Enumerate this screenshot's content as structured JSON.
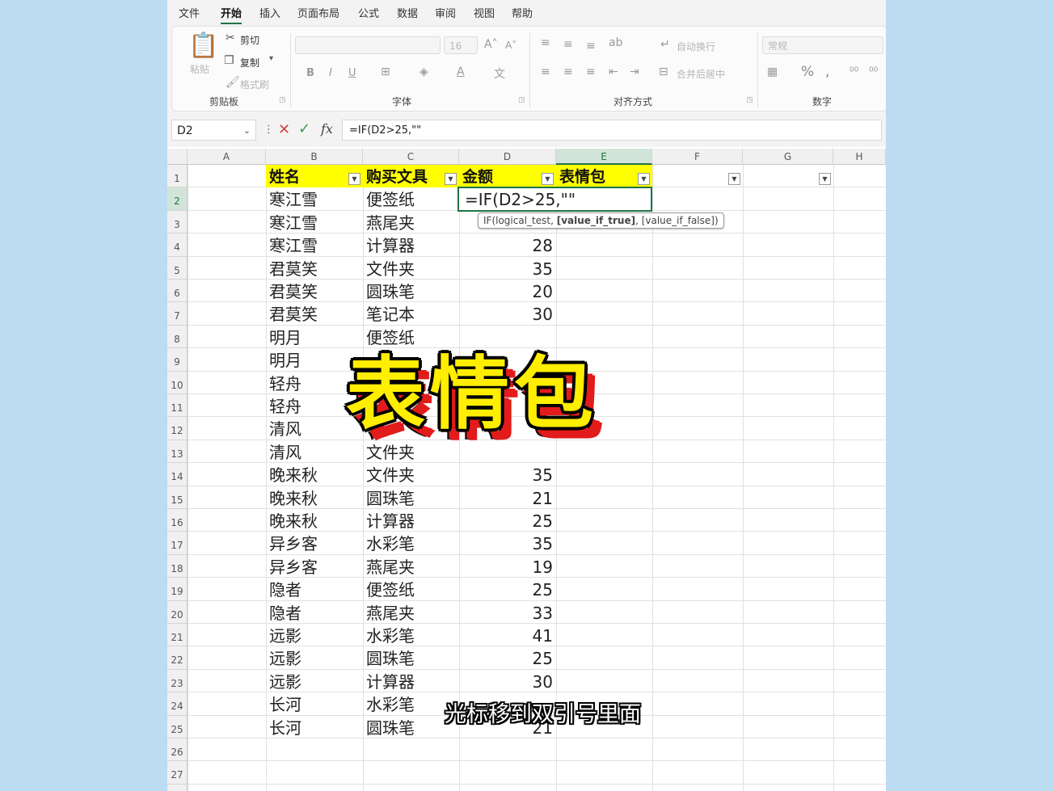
{
  "menu": [
    "文件",
    "开始",
    "插入",
    "页面布局",
    "公式",
    "数据",
    "审阅",
    "视图",
    "帮助"
  ],
  "ribbon": {
    "paste": "粘贴",
    "cut": "剪切",
    "copy": "复制",
    "format_painter": "格式刷",
    "clipboard_group": "剪贴板",
    "font_size": "16",
    "font_group": "字体",
    "wrap_text": "自动换行",
    "merge_center": "合并后居中",
    "align_group": "对齐方式",
    "number_format": "常规",
    "number_group": "数字"
  },
  "formula_bar": {
    "name_box": "D2",
    "fx": "fx",
    "formula": "=IF(D2>25,\"\""
  },
  "columns": [
    "A",
    "B",
    "C",
    "D",
    "E",
    "F",
    "G",
    "H"
  ],
  "header_row": [
    "姓名",
    "购买文具",
    "金额",
    "表情包"
  ],
  "rows": [
    [
      "寒江雪",
      "便签纸",
      ""
    ],
    [
      "寒江雪",
      "燕尾夹",
      ""
    ],
    [
      "寒江雪",
      "计算器",
      "28"
    ],
    [
      "君莫笑",
      "文件夹",
      "35"
    ],
    [
      "君莫笑",
      "圆珠笔",
      "20"
    ],
    [
      "君莫笑",
      "笔记本",
      "30"
    ],
    [
      "明月",
      "便签纸",
      ""
    ],
    [
      "明月",
      "",
      ""
    ],
    [
      "轻舟",
      "",
      ""
    ],
    [
      "轻舟",
      "",
      ""
    ],
    [
      "清风",
      "",
      ""
    ],
    [
      "清风",
      "文件夹",
      ""
    ],
    [
      "晚来秋",
      "文件夹",
      "35"
    ],
    [
      "晚来秋",
      "圆珠笔",
      "21"
    ],
    [
      "晚来秋",
      "计算器",
      "25"
    ],
    [
      "异乡客",
      "水彩笔",
      "35"
    ],
    [
      "异乡客",
      "燕尾夹",
      "19"
    ],
    [
      "隐者",
      "便签纸",
      "25"
    ],
    [
      "隐者",
      "燕尾夹",
      "33"
    ],
    [
      "远影",
      "水彩笔",
      "41"
    ],
    [
      "远影",
      "圆珠笔",
      "25"
    ],
    [
      "远影",
      "计算器",
      "30"
    ],
    [
      "长河",
      "水彩笔",
      ""
    ],
    [
      "长河",
      "圆珠笔",
      "21"
    ]
  ],
  "active_cell_text": "=IF(D2>25,\"\"",
  "tooltip": {
    "prefix": "IF(logical_test, ",
    "bold": "[value_if_true]",
    "suffix": ", [value_if_false])"
  },
  "overlay_title": "表情包",
  "subtitle": "光标移到双引号里面",
  "colors": {
    "header_fill": "#ffff00",
    "accent": "#217346",
    "overlay_text": "#ffee00",
    "overlay_shadow": "#e21b1b"
  }
}
